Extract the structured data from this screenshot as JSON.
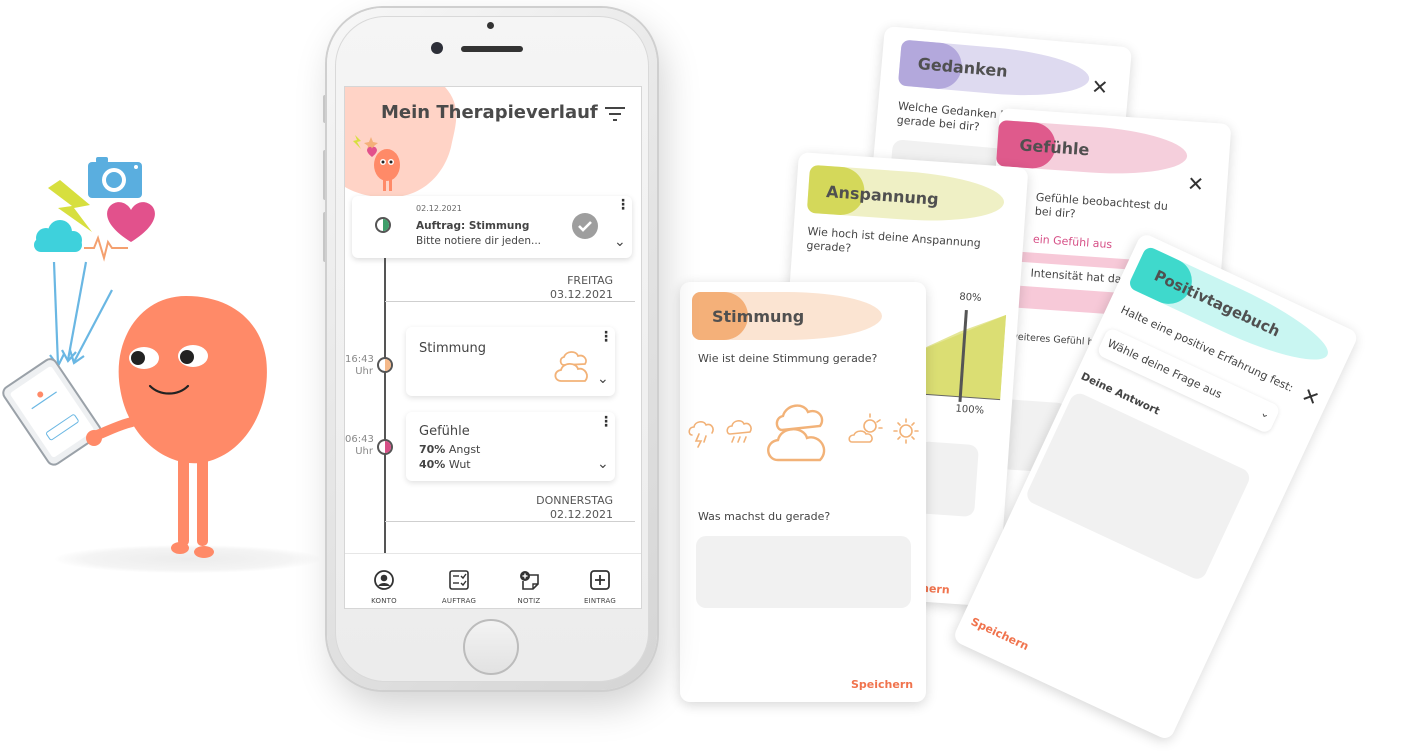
{
  "phone": {
    "title": "Mein Therapieverlauf",
    "task_card": {
      "date": "02.12.2021",
      "title": "Auftrag: Stimmung",
      "subtitle": "Bitte notiere dir jeden..."
    },
    "days": [
      {
        "weekday": "FREITAG",
        "date": "03.12.2021"
      },
      {
        "weekday": "DONNERSTAG",
        "date": "02.12.2021"
      }
    ],
    "entries": [
      {
        "time": "16:43",
        "time_unit": "Uhr",
        "title": "Stimmung",
        "icon": "cloud-icon",
        "color": "#f5b98a"
      },
      {
        "time": "06:43",
        "time_unit": "Uhr",
        "title": "Gefühle",
        "lines": [
          {
            "value": "70%",
            "label": "Angst"
          },
          {
            "value": "40%",
            "label": "Wut"
          }
        ],
        "color": "#d64f86"
      }
    ],
    "nav": [
      {
        "label": "KONTO",
        "icon": "account-icon"
      },
      {
        "label": "AUFTRAG",
        "icon": "task-icon"
      },
      {
        "label": "NOTIZ",
        "icon": "note-icon"
      },
      {
        "label": "EINTRAG",
        "icon": "add-entry-icon"
      }
    ]
  },
  "cards": {
    "gedanken": {
      "title": "Gedanken",
      "question_1": "Welche Gedanken beobachtest du",
      "question_2": "gerade bei dir?",
      "color": "#b9aee0"
    },
    "gefuehle": {
      "title": "Gefühle",
      "question_1": "Gefühle beobachtest du",
      "question_2": "bei dir?",
      "select_emotion": "ein Gefühl aus",
      "intensity": "Intensität hat das Gefü",
      "add_more": "weiteres Gefühl hinzufü",
      "save": "ichern",
      "color": "#e47aa4"
    },
    "anspannung": {
      "title": "Anspannung",
      "question_1": "Wie hoch ist deine Anspannung",
      "question_2": "gerade?",
      "level_label": "80%",
      "max_label": "100%",
      "level": 0.8,
      "save": "ichern",
      "color": "#d9dc6a"
    },
    "stimmung": {
      "title": "Stimmung",
      "question": "Wie ist deine Stimmung gerade?",
      "moods": [
        "thunderstorm-icon",
        "rain-icon",
        "cloudy-icon",
        "sun-cloud-icon",
        "sun-icon"
      ],
      "selected_mood": "cloudy-icon",
      "activity_question": "Was machst du gerade?",
      "save": "Speichern",
      "color": "#f4b079"
    },
    "positivtagebuch": {
      "title": "Positivtagebuch",
      "question": "Halte eine positive Erfahrung fest:",
      "select_question": "Wähle deine Frage aus",
      "answer_label": "Deine Antwort",
      "save": "Speichern",
      "color": "#5fe0d6"
    }
  },
  "colors": {
    "mascot": "#ff8a68",
    "accent": "#f0734d",
    "arrows": "#6ab7e3"
  }
}
